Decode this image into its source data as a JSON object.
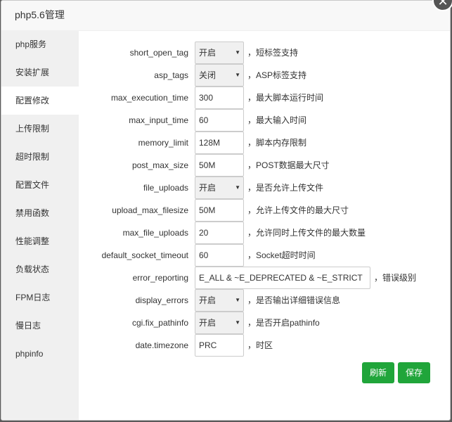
{
  "dialog": {
    "title": "php5.6管理",
    "close_glyph": "✕"
  },
  "sidebar": {
    "items": [
      {
        "label": "php服务"
      },
      {
        "label": "安装扩展"
      },
      {
        "label": "配置修改",
        "active": true
      },
      {
        "label": "上传限制"
      },
      {
        "label": "超时限制"
      },
      {
        "label": "配置文件"
      },
      {
        "label": "禁用函数"
      },
      {
        "label": "性能调整"
      },
      {
        "label": "负载状态"
      },
      {
        "label": "FPM日志"
      },
      {
        "label": "慢日志"
      },
      {
        "label": "phpinfo"
      }
    ]
  },
  "settings": [
    {
      "key": "short_open_tag",
      "type": "select",
      "value": "开启",
      "note": "，短标签支持"
    },
    {
      "key": "asp_tags",
      "type": "select",
      "value": "关闭",
      "note": "，ASP标签支持"
    },
    {
      "key": "max_execution_time",
      "type": "input",
      "value": "300",
      "note": "，最大脚本运行时间"
    },
    {
      "key": "max_input_time",
      "type": "input",
      "value": "60",
      "note": "，最大输入时间"
    },
    {
      "key": "memory_limit",
      "type": "input",
      "value": "128M",
      "note": "，脚本内存限制"
    },
    {
      "key": "post_max_size",
      "type": "input",
      "value": "50M",
      "note": "，POST数据最大尺寸"
    },
    {
      "key": "file_uploads",
      "type": "select",
      "value": "开启",
      "note": "，是否允许上传文件"
    },
    {
      "key": "upload_max_filesize",
      "type": "input",
      "value": "50M",
      "note": "，允许上传文件的最大尺寸"
    },
    {
      "key": "max_file_uploads",
      "type": "input",
      "value": "20",
      "note": "，允许同时上传文件的最大数量"
    },
    {
      "key": "default_socket_timeout",
      "type": "input",
      "value": "60",
      "note": "，Socket超时时间"
    },
    {
      "key": "error_reporting",
      "type": "input",
      "value": "E_ALL & ~E_DEPRECATED & ~E_STRICT",
      "note": "，错误级别"
    },
    {
      "key": "display_errors",
      "type": "select",
      "value": "开启",
      "note": "，是否输出详细错误信息"
    },
    {
      "key": "cgi.fix_pathinfo",
      "type": "select",
      "value": "开启",
      "note": "，是否开启pathinfo"
    },
    {
      "key": "date.timezone",
      "type": "input",
      "value": "PRC",
      "note": "，时区"
    }
  ],
  "actions": {
    "refresh_label": "刷新",
    "save_label": "保存"
  },
  "colors": {
    "accent": "#20a53a"
  }
}
